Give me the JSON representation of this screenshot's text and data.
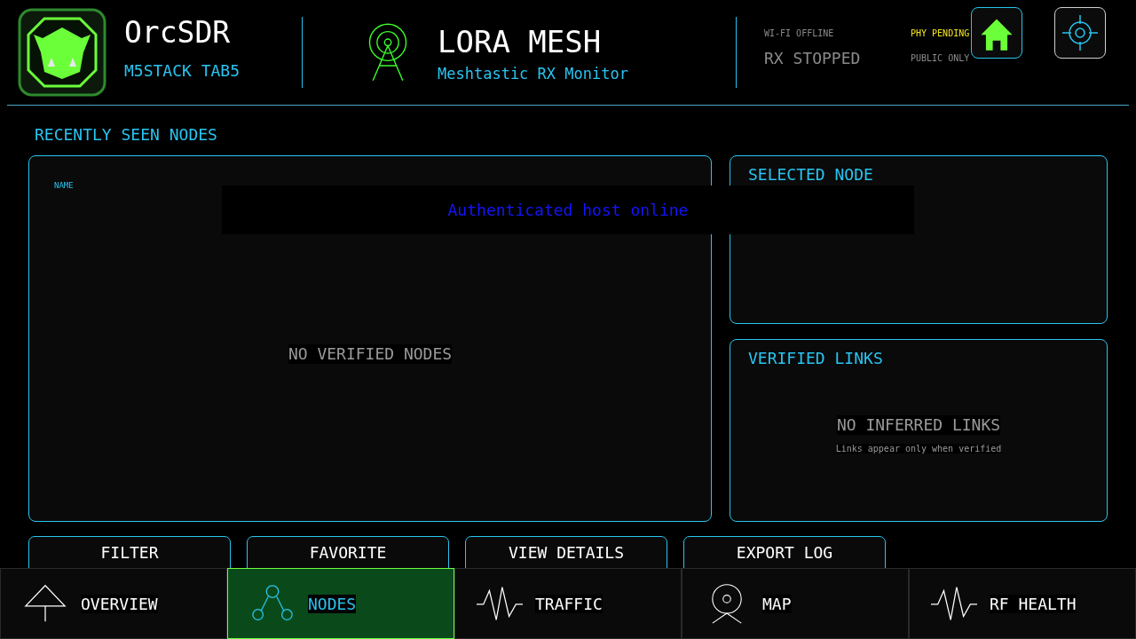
{
  "brand": {
    "title": "OrcSDR",
    "subtitle": "M5STACK TAB5"
  },
  "app": {
    "title": "LORA MESH",
    "subtitle": "Meshtastic RX Monitor"
  },
  "status": [
    {
      "label": "WI-FI OFFLINE",
      "color": "#8a8a8a"
    },
    {
      "label": "PHY PENDING",
      "color": "#f5e61e"
    },
    {
      "label": "RX STOPPED",
      "color": "#8a8a8a"
    },
    {
      "label": "PUBLIC ONLY",
      "color": "#8a8a8a"
    }
  ],
  "header_buttons": [
    {
      "kind": "home",
      "selected": true
    },
    {
      "kind": "locate",
      "selected": false
    }
  ],
  "section_title": "RECENTLY SEEN NODES",
  "table": {
    "columns": [
      "NAME"
    ],
    "empty": "NO VERIFIED NODES"
  },
  "toast": "Authenticated host online",
  "selected_node": {
    "title": "SELECTED NODE"
  },
  "links": {
    "title": "VERIFIED LINKS",
    "empty": "NO INFERRED LINKS",
    "hint": "Links appear only when verified"
  },
  "actions": [
    "FILTER",
    "FAVORITE",
    "VIEW DETAILS",
    "EXPORT LOG"
  ],
  "nav": [
    {
      "label": "OVERVIEW",
      "kind": "tower",
      "selected": false
    },
    {
      "label": "NODES",
      "kind": "nodes",
      "selected": true
    },
    {
      "label": "TRAFFIC",
      "kind": "pulse",
      "selected": false
    },
    {
      "label": "MAP",
      "kind": "dish",
      "selected": false
    },
    {
      "label": "RF HEALTH",
      "kind": "pulse",
      "selected": false
    }
  ]
}
